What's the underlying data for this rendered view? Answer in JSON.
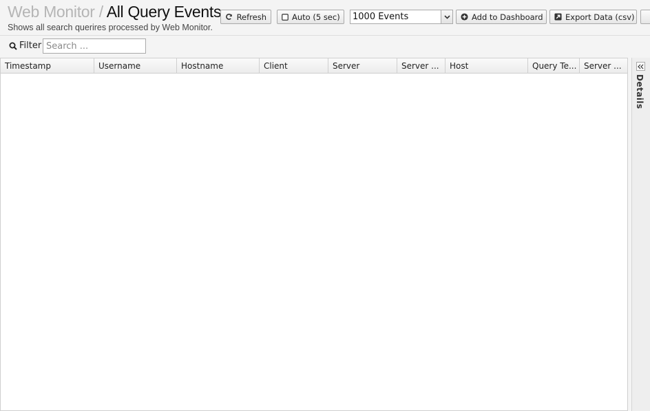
{
  "header": {
    "breadcrumb_parent": "Web Monitor",
    "separator": "/",
    "title": "All Query Events",
    "subtitle": "Shows all search querires processed by Web Monitor."
  },
  "toolbar": {
    "refresh_label": "Refresh",
    "auto_label": "Auto (5 sec)",
    "events_select_value": "1000 Events",
    "add_dashboard_label": "Add to Dashboard",
    "export_label": "Export Data (csv)"
  },
  "filter": {
    "label": "Filter",
    "placeholder": "Search ..."
  },
  "grid": {
    "columns": [
      "Timestamp",
      "Username",
      "Hostname",
      "Client",
      "Server",
      "Server ...",
      "Host",
      "Query Te...",
      "Server ..."
    ],
    "rows": []
  },
  "details_panel": {
    "label": "Details"
  },
  "icons": {
    "refresh": "refresh-icon",
    "checkbox": "checkbox-icon",
    "chevron": "chevron-down-icon",
    "add": "plus-circle-icon",
    "export": "external-link-icon",
    "search": "search-icon",
    "collapse": "double-chevron-left-icon"
  },
  "colors": {
    "toolbar_bg": "#f4f4f4",
    "breadcrumb_muted": "#b5b5b5",
    "border": "#a9a9a9"
  }
}
